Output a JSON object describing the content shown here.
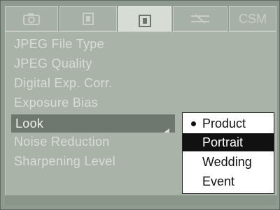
{
  "tabs": [
    {
      "label": "",
      "icon": "camera-icon"
    },
    {
      "label": "",
      "icon": "image-icon"
    },
    {
      "label": "",
      "icon": "custom-settings-icon"
    },
    {
      "label": "",
      "icon": "tools-icon"
    },
    {
      "label": "CSM",
      "icon": ""
    }
  ],
  "menu": {
    "items": [
      {
        "label": "JPEG File Type"
      },
      {
        "label": "JPEG Quality"
      },
      {
        "label": "Digital Exp. Corr."
      },
      {
        "label": "Exposure Bias"
      },
      {
        "label": "Look"
      },
      {
        "label": "Noise Reduction"
      },
      {
        "label": "Sharpening Level"
      }
    ],
    "selected": "Look"
  },
  "popup": {
    "options": [
      "Product",
      "Portrait",
      "Wedding",
      "Event"
    ],
    "current": "Product",
    "highlighted": "Portrait"
  }
}
